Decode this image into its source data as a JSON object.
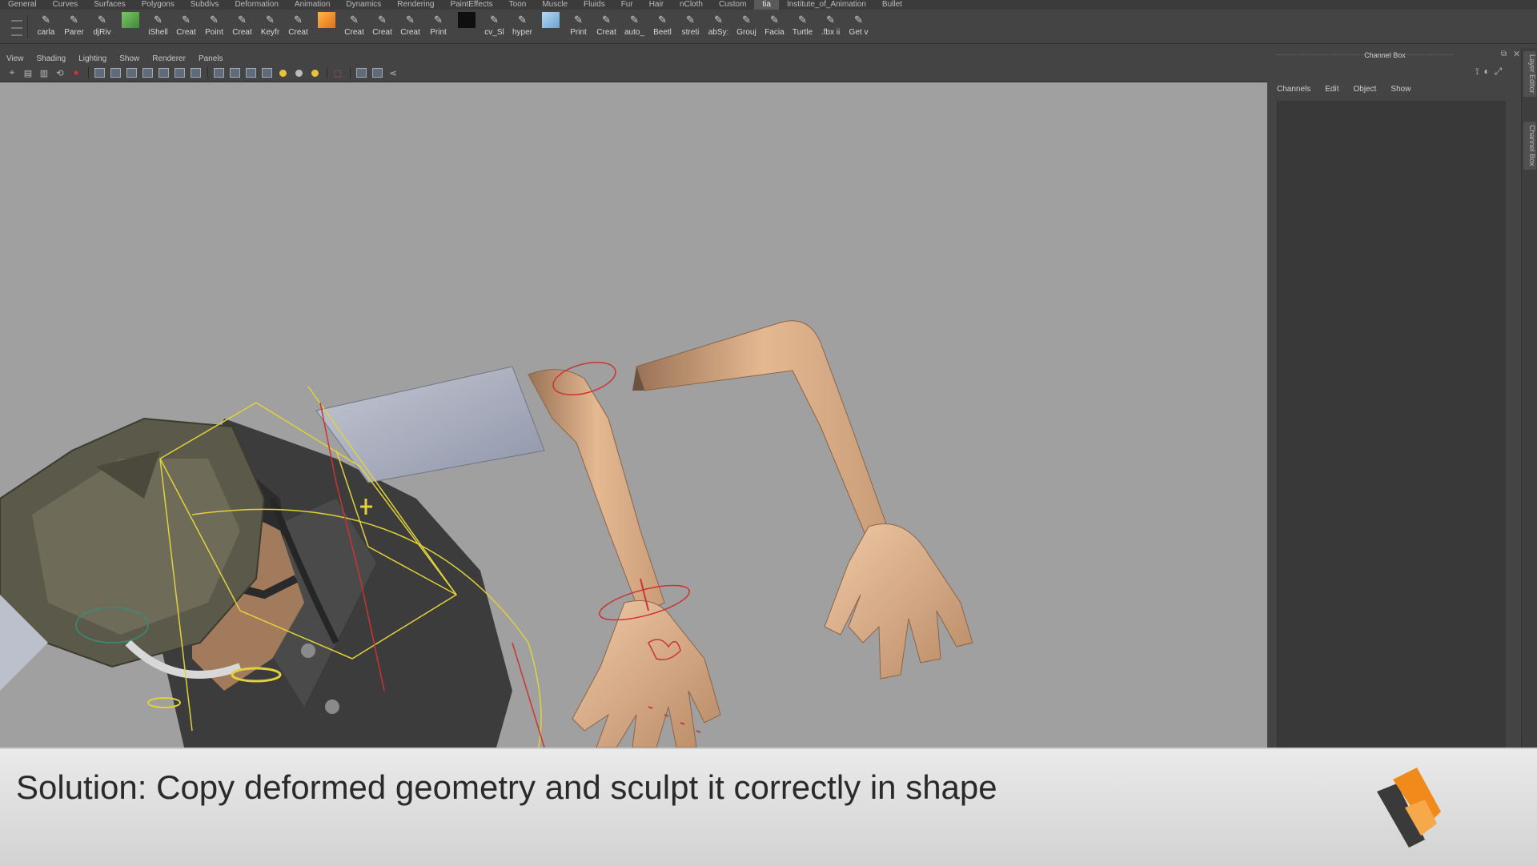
{
  "shelf_tabs": [
    "General",
    "Curves",
    "Surfaces",
    "Polygons",
    "Subdivs",
    "Deformation",
    "Animation",
    "Dynamics",
    "Rendering",
    "PaintEffects",
    "Toon",
    "Muscle",
    "Fluids",
    "Fur",
    "Hair",
    "nCloth",
    "Custom",
    "tia",
    "Institute_of_Animation",
    "Bullet"
  ],
  "shelf_tools": [
    {
      "label": "carla",
      "color": "none"
    },
    {
      "label": "Parer",
      "color": "none"
    },
    {
      "label": "djRiv",
      "color": "none"
    },
    {
      "label": "",
      "color": "green"
    },
    {
      "label": "iShell",
      "color": "none"
    },
    {
      "label": "Creat",
      "color": "none"
    },
    {
      "label": "Point",
      "color": "none"
    },
    {
      "label": "Creat",
      "color": "none"
    },
    {
      "label": "Keyfr",
      "color": "none"
    },
    {
      "label": "Creat",
      "color": "none"
    },
    {
      "label": "",
      "color": "orange"
    },
    {
      "label": "Creat",
      "color": "none"
    },
    {
      "label": "Creat",
      "color": "none"
    },
    {
      "label": "Creat",
      "color": "none"
    },
    {
      "label": "Print",
      "color": "none"
    },
    {
      "label": "",
      "color": "black"
    },
    {
      "label": "cv_Sl",
      "color": "none"
    },
    {
      "label": "hyper",
      "color": "none"
    },
    {
      "label": "",
      "color": "blue"
    },
    {
      "label": "Print",
      "color": "none"
    },
    {
      "label": "Creat",
      "color": "none"
    },
    {
      "label": "auto_",
      "color": "none"
    },
    {
      "label": "Beetl",
      "color": "none"
    },
    {
      "label": "streti",
      "color": "none"
    },
    {
      "label": "abSy:",
      "color": "none"
    },
    {
      "label": "Grouj",
      "color": "none"
    },
    {
      "label": "Facia",
      "color": "none"
    },
    {
      "label": "Turtle",
      "color": "none"
    },
    {
      "label": ".fbx ii",
      "color": "none"
    },
    {
      "label": "Get v",
      "color": "none"
    }
  ],
  "panel_menu": [
    "View",
    "Shading",
    "Lighting",
    "Show",
    "Renderer",
    "Panels"
  ],
  "channel_box": {
    "title": "Channel Box",
    "menu": [
      "Channels",
      "Edit",
      "Object",
      "Show"
    ],
    "side_tabs": [
      "Layer Editor",
      "Channel Box"
    ]
  },
  "caption": "Solution: Copy deformed geometry and sculpt it correctly in shape",
  "colors": {
    "viewport_bg": "#a0a0a0",
    "skin": "#e0b591",
    "ui_dark": "#444444",
    "logo_orange": "#f08a1a",
    "logo_dark": "#3a3a3a"
  }
}
